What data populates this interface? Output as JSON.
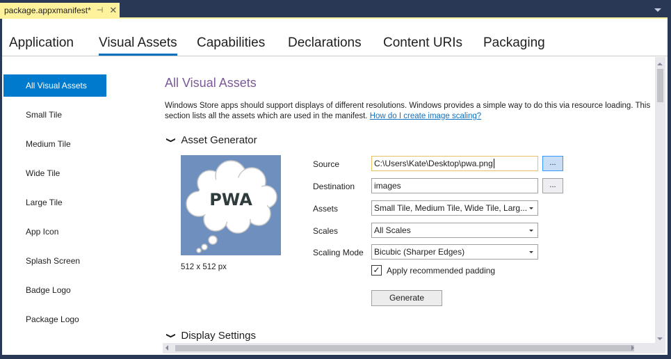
{
  "document_tab": {
    "title": "package.appxmanifest*",
    "pin_icon": "pin-icon",
    "close_icon": "close-icon"
  },
  "nav_tabs": [
    {
      "label": "Application",
      "active": false
    },
    {
      "label": "Visual Assets",
      "active": true
    },
    {
      "label": "Capabilities",
      "active": false
    },
    {
      "label": "Declarations",
      "active": false
    },
    {
      "label": "Content URIs",
      "active": false
    },
    {
      "label": "Packaging",
      "active": false
    }
  ],
  "sidebar": {
    "items": [
      {
        "label": "All Visual Assets",
        "active": true
      },
      {
        "label": "Small Tile"
      },
      {
        "label": "Medium Tile"
      },
      {
        "label": "Wide Tile"
      },
      {
        "label": "Large Tile"
      },
      {
        "label": "App Icon"
      },
      {
        "label": "Splash Screen"
      },
      {
        "label": "Badge Logo"
      },
      {
        "label": "Package Logo"
      }
    ]
  },
  "content": {
    "title": "All Visual Assets",
    "description": "Windows Store apps should support displays of different resolutions. Windows provides a simple way to do this via resource loading. This section lists all the assets which are used in the manifest.",
    "help_link": "How do I create image scaling?",
    "asset_generator": {
      "header": "Asset Generator",
      "preview_text": "PWA",
      "preview_caption": "512 x 512 px",
      "source_label": "Source",
      "source_value": "C:\\Users\\Kate\\Desktop\\pwa.png",
      "destination_label": "Destination",
      "destination_value": "images",
      "browse_label": "...",
      "assets_label": "Assets",
      "assets_value": "Small Tile, Medium Tile, Wide Tile, Larg...",
      "scales_label": "Scales",
      "scales_value": "All Scales",
      "scaling_mode_label": "Scaling Mode",
      "scaling_mode_value": "Bicubic (Sharper Edges)",
      "padding_label": "Apply recommended padding",
      "padding_checked": true,
      "checkmark": "✓",
      "generate_label": "Generate"
    },
    "display_settings_header": "Display Settings",
    "chevron": "❯"
  },
  "colors": {
    "accent": "#007acc",
    "tab_highlight": "#fff29d",
    "chrome": "#293955",
    "title": "#7a5a96"
  }
}
